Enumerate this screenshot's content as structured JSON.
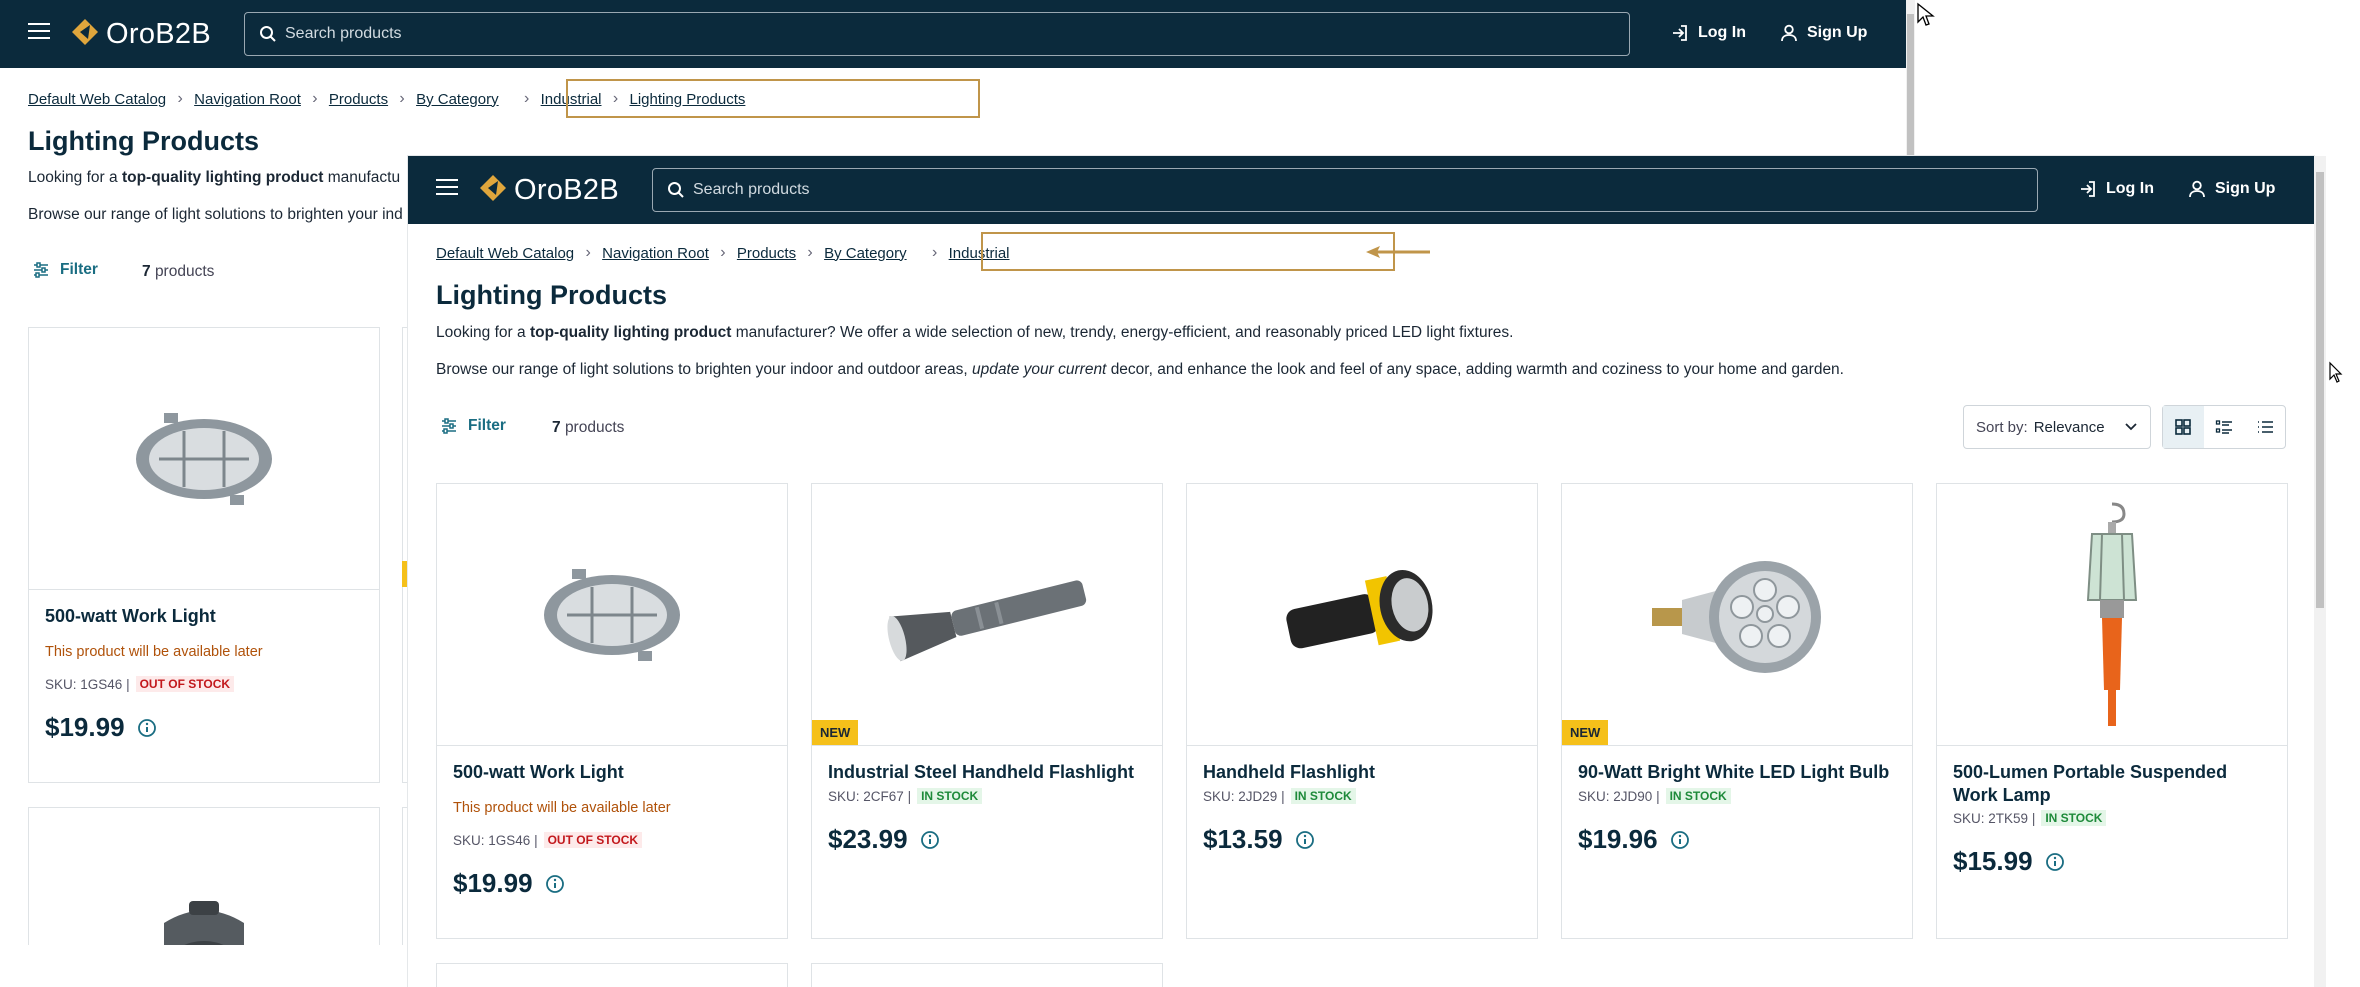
{
  "app": {
    "logo_text": "OroB2B",
    "search_placeholder": "Search products",
    "login_label": "Log In",
    "signup_label": "Sign Up"
  },
  "back_window": {
    "breadcrumbs": [
      "Default Web Catalog",
      "Navigation Root",
      "Products",
      "By Category",
      "Industrial",
      "Lighting Products"
    ],
    "title": "Lighting Products",
    "intro_start": "Looking for a",
    "intro_bold": "top-quality lighting product",
    "intro_rest": "manufactu",
    "browse_text": "Browse our range of light solutions to brighten your ind",
    "filter_label": "Filter",
    "count": "7",
    "count_label": "products",
    "product": {
      "name": "500-watt Work Light",
      "availability": "This product will be available later",
      "sku_label": "SKU:",
      "sku": "1GS46",
      "stock": "OUT OF STOCK",
      "price": "$19.99"
    }
  },
  "front_window": {
    "breadcrumbs": [
      "Default Web Catalog",
      "Navigation Root",
      "Products",
      "By Category",
      "Industrial"
    ],
    "title": "Lighting Products",
    "intro_start": "Looking for a",
    "intro_bold": "top-quality lighting product",
    "intro_rest": "manufacturer? We offer a wide selection of new, trendy, energy-efficient, and reasonably priced LED light fixtures.",
    "browse_start": "Browse our range of light solutions to brighten your indoor and outdoor areas,",
    "browse_italic": "update your current",
    "browse_rest": "decor, and enhance the look and feel of any space, adding warmth and coziness to your home and garden.",
    "filter_label": "Filter",
    "count": "7",
    "count_label": "products",
    "sort_prefix": "Sort by:",
    "sort_value": "Relevance",
    "products": [
      {
        "name": "500-watt Work Light",
        "availability": "This product will be available later",
        "sku_label": "SKU:",
        "sku": "1GS46",
        "stock": "OUT OF STOCK",
        "price": "$19.99",
        "badge": ""
      },
      {
        "name": "Industrial Steel Handheld Flashlight",
        "sku_label": "SKU:",
        "sku": "2CF67",
        "stock": "IN STOCK",
        "price": "$23.99",
        "badge": "NEW"
      },
      {
        "name": "Handheld Flashlight",
        "sku_label": "SKU:",
        "sku": "2JD29",
        "stock": "IN STOCK",
        "price": "$13.59",
        "badge": ""
      },
      {
        "name": "90-Watt Bright White LED Light Bulb",
        "sku_label": "SKU:",
        "sku": "2JD90",
        "stock": "IN STOCK",
        "price": "$19.96",
        "badge": "NEW"
      },
      {
        "name": "500-Lumen Portable Suspended Work Lamp",
        "sku_label": "SKU:",
        "sku": "2TK59",
        "stock": "IN STOCK",
        "price": "$15.99",
        "badge": ""
      }
    ]
  },
  "colors": {
    "header_bg": "#0b2a3c",
    "accent": "#1a6d82",
    "highlight": "#c0954a",
    "badge": "#f5c01a",
    "out_of_stock": "#c2181c",
    "in_stock": "#1e8a3a"
  }
}
